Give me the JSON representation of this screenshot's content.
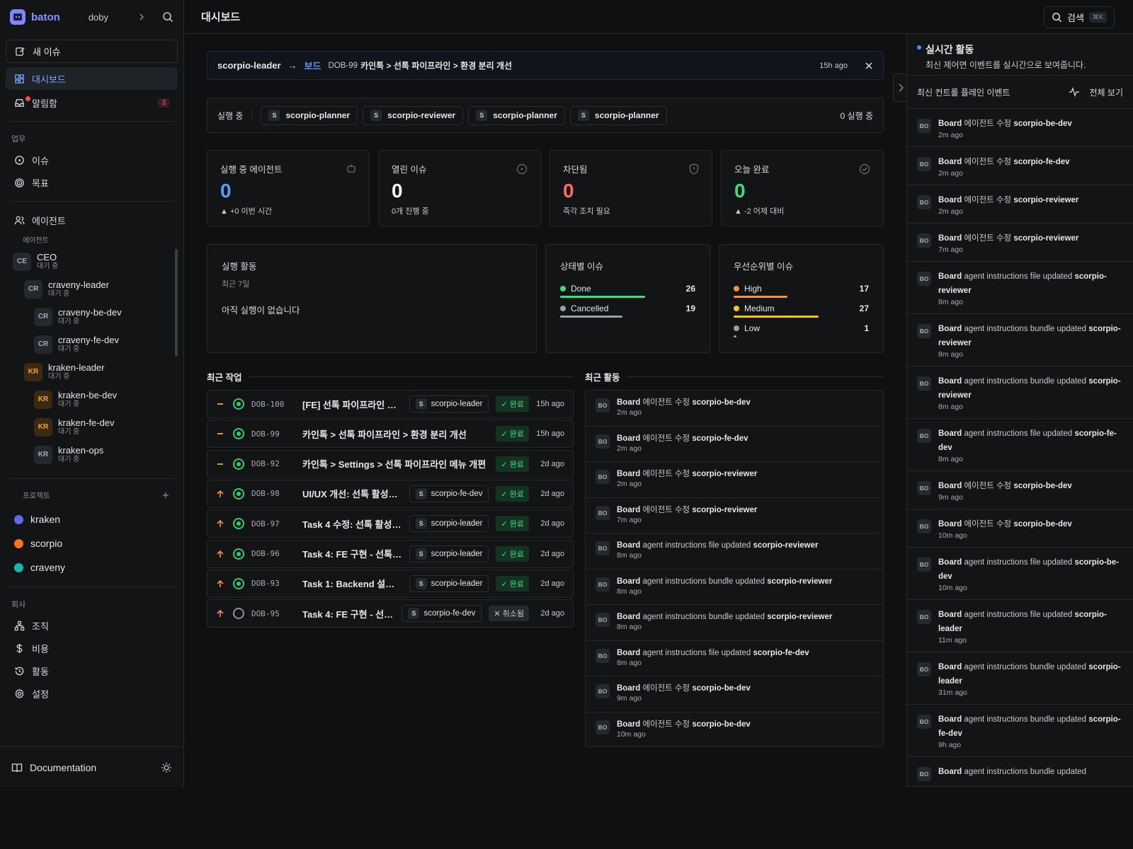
{
  "sidebar": {
    "brand": "baton",
    "workspace": "doby",
    "new_issue": "새 이슈",
    "nav": [
      {
        "label": "대시보드",
        "active": true
      },
      {
        "label": "알림함",
        "badge": "3"
      }
    ],
    "work_section": "업무",
    "work_items": [
      "이슈",
      "목표"
    ],
    "agents_label": "에이전트",
    "agents_sub": "에이전트",
    "agents": [
      {
        "initials": "CE",
        "name": "CEO",
        "status": "대기 중",
        "level": 0
      },
      {
        "initials": "CR",
        "name": "craveny-leader",
        "status": "대기 중",
        "level": 1
      },
      {
        "initials": "CR",
        "name": "craveny-be-dev",
        "status": "대기 중",
        "level": 2
      },
      {
        "initials": "CR",
        "name": "craveny-fe-dev",
        "status": "대기 중",
        "level": 2
      },
      {
        "initials": "KR",
        "name": "kraken-leader",
        "status": "대기 중",
        "level": 1,
        "accent": true
      },
      {
        "initials": "KR",
        "name": "kraken-be-dev",
        "status": "대기 중",
        "level": 2,
        "accent": true
      },
      {
        "initials": "KR",
        "name": "kraken-fe-dev",
        "status": "대기 중",
        "level": 2,
        "accent": true
      },
      {
        "initials": "KR",
        "name": "kraken-ops",
        "status": "대기 중",
        "level": 2
      }
    ],
    "projects_label": "프로젝트",
    "projects": [
      {
        "name": "kraken",
        "color": "#6366f1"
      },
      {
        "name": "scorpio",
        "color": "#f97316"
      },
      {
        "name": "craveny",
        "color": "#14b8a6"
      }
    ],
    "company_label": "회사",
    "company_items": [
      "조직",
      "비용",
      "활동",
      "설정"
    ],
    "documentation": "Documentation"
  },
  "header": {
    "title": "대시보드",
    "search_label": "검색",
    "shortcut": "⌘K"
  },
  "breadcrumb": {
    "agent": "scorpio-leader",
    "board": "보드",
    "issue_id": "DOB-99",
    "issue_title": "카인톡 > 선톡 파이프라인 > 환경 분리 개선",
    "time": "15h ago"
  },
  "running": {
    "label": "실행 중",
    "chips": [
      "scorpio-planner",
      "scorpio-reviewer",
      "scorpio-planner",
      "scorpio-planner"
    ],
    "count": "0 실행 중"
  },
  "stats": [
    {
      "label": "실행 중 에이전트",
      "value": "0",
      "sub": "▲ +0 이번 시간",
      "color": "#5b9cff",
      "icon": "robot-icon"
    },
    {
      "label": "열린 이슈",
      "value": "0",
      "sub": "0개 진행 중",
      "color": "#ffffff",
      "icon": "circle-dot-icon"
    },
    {
      "label": "차단됨",
      "value": "0",
      "sub": "즉각 조치 필요",
      "color": "#ff6b6b",
      "icon": "shield-icon"
    },
    {
      "label": "오늘 완료",
      "value": "0",
      "sub": "▲ -2 어제 대비",
      "color": "#3ddc84",
      "icon": "check-circle-icon"
    }
  ],
  "activity_panel": {
    "title": "실행 활동",
    "period": "최근 7일",
    "empty": "아직 실행이 없습니다"
  },
  "status_panel": {
    "title": "상태별 이슈",
    "items": [
      {
        "label": "Done",
        "value": 26,
        "color": "#3ddc84"
      },
      {
        "label": "Cancelled",
        "value": 19,
        "color": "#9aa0a6"
      }
    ]
  },
  "priority_panel": {
    "title": "우선순위별 이슈",
    "items": [
      {
        "label": "High",
        "value": 17,
        "color": "#f5923e"
      },
      {
        "label": "Medium",
        "value": 27,
        "color": "#f5c518"
      },
      {
        "label": "Low",
        "value": 1,
        "color": "#9aa0a6"
      }
    ]
  },
  "recent_tasks": {
    "title": "최근 작업",
    "items": [
      {
        "priority": "medium",
        "id": "DOB-100",
        "title": "[FE] 선톡 파이프라인 환...",
        "agent": "scorpio-leader",
        "status": "done",
        "status_label": "✓ 완료",
        "time": "15h ago"
      },
      {
        "priority": "medium",
        "id": "DOB-99",
        "title": "카인톡 > 선톡 파이프라인 > 환경 분리 개선",
        "agent": "",
        "status": "done",
        "status_label": "✓ 완료",
        "time": "15h ago"
      },
      {
        "priority": "medium",
        "id": "DOB-92",
        "title": "카인톡 > Settings > 선톡 파이프라인 메뉴 개편",
        "agent": "",
        "status": "done",
        "status_label": "✓ 완료",
        "time": "2d ago"
      },
      {
        "priority": "high",
        "id": "DOB-98",
        "title": "UI/UX 개선: 선톡 활성화 ...",
        "agent": "scorpio-fe-dev",
        "status": "done",
        "status_label": "✓ 완료",
        "time": "2d ago"
      },
      {
        "priority": "high",
        "id": "DOB-97",
        "title": "Task 4 수정: 선톡 활성화 ...",
        "agent": "scorpio-leader",
        "status": "done",
        "status_label": "✓ 완료",
        "time": "2d ago"
      },
      {
        "priority": "high",
        "id": "DOB-96",
        "title": "Task 4: FE 구현 - 선톡 ...",
        "agent": "scorpio-leader",
        "status": "done",
        "status_label": "✓ 완료",
        "time": "2d ago"
      },
      {
        "priority": "high",
        "id": "DOB-93",
        "title": "Task 1: Backend 설정 A...",
        "agent": "scorpio-leader",
        "status": "done",
        "status_label": "✓ 완료",
        "time": "2d ago"
      },
      {
        "priority": "high",
        "id": "DOB-95",
        "title": "Task 4: FE 구현 - 선톡 ...",
        "agent": "scorpio-fe-dev",
        "status": "cancelled",
        "status_label": "✕ 취소됨",
        "time": "2d ago"
      }
    ]
  },
  "recent_activity": {
    "title": "최근 활동",
    "items": [
      {
        "actor": "Board",
        "action": "에이전트 수정",
        "target": "scorpio-be-dev",
        "time": "2m ago"
      },
      {
        "actor": "Board",
        "action": "에이전트 수정",
        "target": "scorpio-fe-dev",
        "time": "2m ago"
      },
      {
        "actor": "Board",
        "action": "에이전트 수정",
        "target": "scorpio-reviewer",
        "time": "2m ago"
      },
      {
        "actor": "Board",
        "action": "에이전트 수정",
        "target": "scorpio-reviewer",
        "time": "7m ago"
      },
      {
        "actor": "Board",
        "action": "agent instructions file updated",
        "target": "scorpio-reviewer",
        "time": "8m ago"
      },
      {
        "actor": "Board",
        "action": "agent instructions bundle updated",
        "target": "scorpio-reviewer",
        "time": "8m ago"
      },
      {
        "actor": "Board",
        "action": "agent instructions bundle updated",
        "target": "scorpio-reviewer",
        "time": "8m ago"
      },
      {
        "actor": "Board",
        "action": "agent instructions file updated",
        "target": "scorpio-fe-dev",
        "time": "8m ago"
      },
      {
        "actor": "Board",
        "action": "에이전트 수정",
        "target": "scorpio-be-dev",
        "time": "9m ago"
      },
      {
        "actor": "Board",
        "action": "에이전트 수정",
        "target": "scorpio-be-dev",
        "time": "10m ago"
      }
    ]
  },
  "live_panel": {
    "title": "실시간 활동",
    "subtitle": "최신 제어면 이벤트를 실시간으로 보여줍니다.",
    "bar_label": "최신 컨트롤 플레인 이벤트",
    "view_all": "전체 보기",
    "items": [
      {
        "actor": "Board",
        "action": "에이전트 수정",
        "target": "scorpio-be-dev",
        "time": "2m ago"
      },
      {
        "actor": "Board",
        "action": "에이전트 수정",
        "target": "scorpio-fe-dev",
        "time": "2m ago"
      },
      {
        "actor": "Board",
        "action": "에이전트 수정",
        "target": "scorpio-reviewer",
        "time": "2m ago"
      },
      {
        "actor": "Board",
        "action": "에이전트 수정",
        "target": "scorpio-reviewer",
        "time": "7m ago"
      },
      {
        "actor": "Board",
        "action": "agent instructions file updated",
        "target": "scorpio-reviewer",
        "time": "8m ago"
      },
      {
        "actor": "Board",
        "action": "agent instructions bundle updated",
        "target": "scorpio-reviewer",
        "time": "8m ago"
      },
      {
        "actor": "Board",
        "action": "agent instructions bundle updated",
        "target": "scorpio-reviewer",
        "time": "8m ago"
      },
      {
        "actor": "Board",
        "action": "agent instructions file updated",
        "target": "scorpio-fe-dev",
        "time": "8m ago"
      },
      {
        "actor": "Board",
        "action": "에이전트 수정",
        "target": "scorpio-be-dev",
        "time": "9m ago"
      },
      {
        "actor": "Board",
        "action": "에이전트 수정",
        "target": "scorpio-be-dev",
        "time": "10m ago"
      },
      {
        "actor": "Board",
        "action": "agent instructions file updated",
        "target": "scorpio-be-dev",
        "time": "10m ago"
      },
      {
        "actor": "Board",
        "action": "agent instructions file updated",
        "target": "scorpio-leader",
        "time": "11m ago"
      },
      {
        "actor": "Board",
        "action": "agent instructions bundle updated",
        "target": "scorpio-leader",
        "time": "31m ago"
      },
      {
        "actor": "Board",
        "action": "agent instructions bundle updated",
        "target": "scorpio-fe-dev",
        "time": "9h ago"
      },
      {
        "actor": "Board",
        "action": "agent instructions bundle updated",
        "target": "",
        "time": ""
      }
    ]
  }
}
